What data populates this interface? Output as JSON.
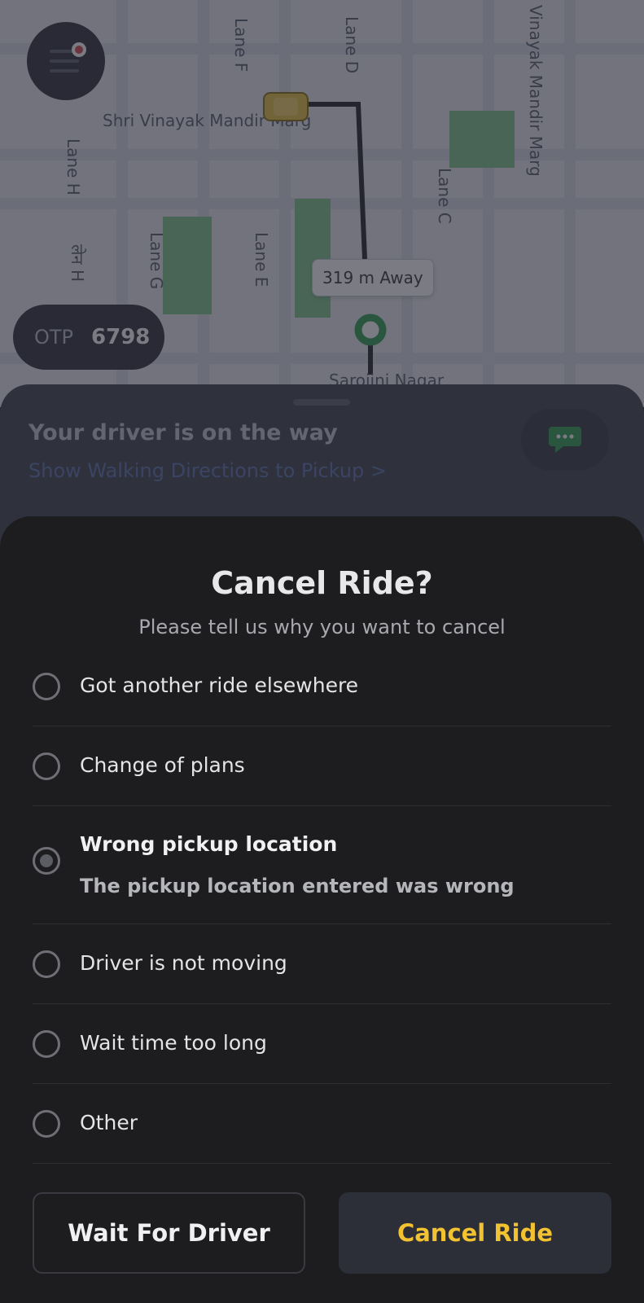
{
  "map": {
    "streets": {
      "lane_h": "Lane H",
      "lane_h_hindi": "लेन H",
      "lane_g": "Lane G",
      "lane_e": "Lane E",
      "lane_f": "Lane F",
      "lane_d": "Lane D",
      "lane_c": "Lane C",
      "shri_vinayak": "Shri Vinayak Mandir Marg",
      "vinayak_mandir": "Vinayak Mandir Marg",
      "sarojini": "Sarojini Nagar"
    },
    "distance_badge": "319 m Away"
  },
  "otp": {
    "label": "OTP",
    "value": "6798"
  },
  "driver_card": {
    "title": "Your driver is on the way",
    "link": "Show Walking Directions to Pickup >"
  },
  "cancel_sheet": {
    "title": "Cancel Ride?",
    "subtitle": "Please tell us why you want to cancel",
    "reasons": [
      {
        "label": "Got another ride elsewhere"
      },
      {
        "label": "Change of plans"
      },
      {
        "label": "Wrong pickup location",
        "detail": "The pickup location entered was wrong",
        "selected": true
      },
      {
        "label": "Driver is not moving"
      },
      {
        "label": "Wait time too long"
      },
      {
        "label": "Other"
      }
    ],
    "wait_button": "Wait For Driver",
    "cancel_button": "Cancel Ride"
  },
  "colors": {
    "accent": "#f2c230",
    "sheet_bg": "#1d1d20",
    "map_bg": "#e9eaee"
  },
  "icons": {
    "menu": "menu-icon",
    "chat": "chat-icon",
    "car": "car-icon",
    "pin": "pickup-pin-icon"
  }
}
